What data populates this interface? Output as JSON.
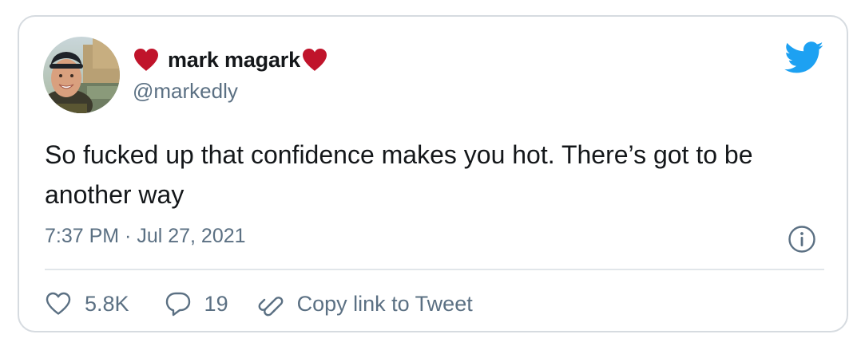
{
  "author": {
    "display_name": "mark magark",
    "handle": "@markedly",
    "avatar_icon": "avatar-photo",
    "name_decoration_icon": "red-heart-icon",
    "heart_color": "#c0142b"
  },
  "brand": {
    "icon": "twitter-bird-icon",
    "color": "#1da1f2"
  },
  "tweet": {
    "text": "So fucked up that confidence makes you hot. There’s got to be another way",
    "timestamp": "7:37 PM · Jul 27, 2021"
  },
  "actions": {
    "likes": "5.8K",
    "replies": "19",
    "copy_link_label": "Copy link to Tweet"
  },
  "colors": {
    "text_primary": "#14171a",
    "text_secondary": "#5b7083",
    "border": "#d6dbe0"
  }
}
